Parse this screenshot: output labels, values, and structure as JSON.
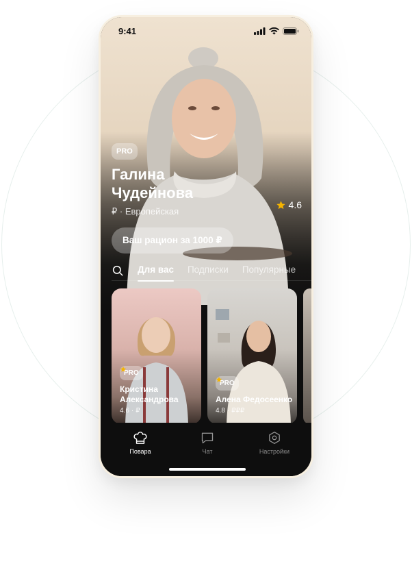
{
  "status_bar": {
    "time": "9:41"
  },
  "hero": {
    "badge": "PRO",
    "name": "Галина Чудейнова",
    "meta": "₽ · Европейская",
    "rating": "4.6",
    "cta_label": "Ваш рацион за 1000 ₽"
  },
  "tabs": [
    {
      "label": "Для вас",
      "active": true
    },
    {
      "label": "Подписки",
      "active": false
    },
    {
      "label": "Популярные",
      "active": false
    }
  ],
  "cards": [
    {
      "badge": "PRO",
      "name": "Кристина Александрова",
      "rating": "4.6",
      "price": "₽"
    },
    {
      "badge": "PRO",
      "name": "Алена Федосеенко",
      "rating": "4.8",
      "price": "₽₽₽"
    }
  ],
  "bottom_nav": [
    {
      "label": "Повара",
      "icon": "chef-hat-icon",
      "active": true
    },
    {
      "label": "Чат",
      "icon": "chat-icon",
      "active": false
    },
    {
      "label": "Настройки",
      "icon": "settings-icon",
      "active": false
    }
  ],
  "colors": {
    "star": "#f5b400",
    "nav_bg": "#0e0e0e",
    "frame": "#f7efe0"
  }
}
